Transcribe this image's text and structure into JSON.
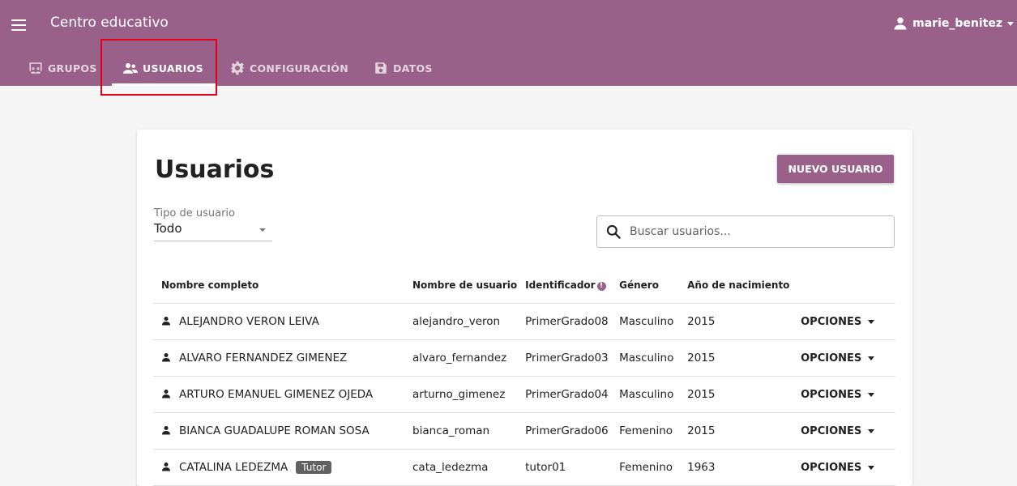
{
  "header": {
    "title": "Centro educativo",
    "username": "marie_benitez"
  },
  "tabs": [
    {
      "label": "GRUPOS"
    },
    {
      "label": "USUARIOS"
    },
    {
      "label": "CONFIGURACIÓN"
    },
    {
      "label": "DATOS"
    }
  ],
  "main": {
    "title": "Usuarios",
    "new_user_label": "NUEVO USUARIO",
    "filter": {
      "label": "Tipo de usuario",
      "value": "Todo"
    },
    "search": {
      "placeholder": "Buscar usuarios..."
    },
    "columns": [
      "Nombre completo",
      "Nombre de usuario",
      "Identificador",
      "Género",
      "Año de nacimiento"
    ],
    "options_label": "OPCIONES",
    "rows": [
      {
        "name": "ALEJANDRO VERON LEIVA",
        "username": "alejandro_veron",
        "id": "PrimerGrado08",
        "gender": "Masculino",
        "year": "2015",
        "badge": ""
      },
      {
        "name": "ALVARO FERNANDEZ GIMENEZ",
        "username": "alvaro_fernandez",
        "id": "PrimerGrado03",
        "gender": "Masculino",
        "year": "2015",
        "badge": ""
      },
      {
        "name": "ARTURO EMANUEL GIMENEZ OJEDA",
        "username": "arturno_gimenez",
        "id": "PrimerGrado04",
        "gender": "Masculino",
        "year": "2015",
        "badge": ""
      },
      {
        "name": "BIANCA GUADALUPE ROMAN SOSA",
        "username": "bianca_roman",
        "id": "PrimerGrado06",
        "gender": "Femenino",
        "year": "2015",
        "badge": ""
      },
      {
        "name": "CATALINA LEDEZMA",
        "username": "cata_ledezma",
        "id": "tutor01",
        "gender": "Femenino",
        "year": "1963",
        "badge": "Tutor"
      }
    ]
  }
}
